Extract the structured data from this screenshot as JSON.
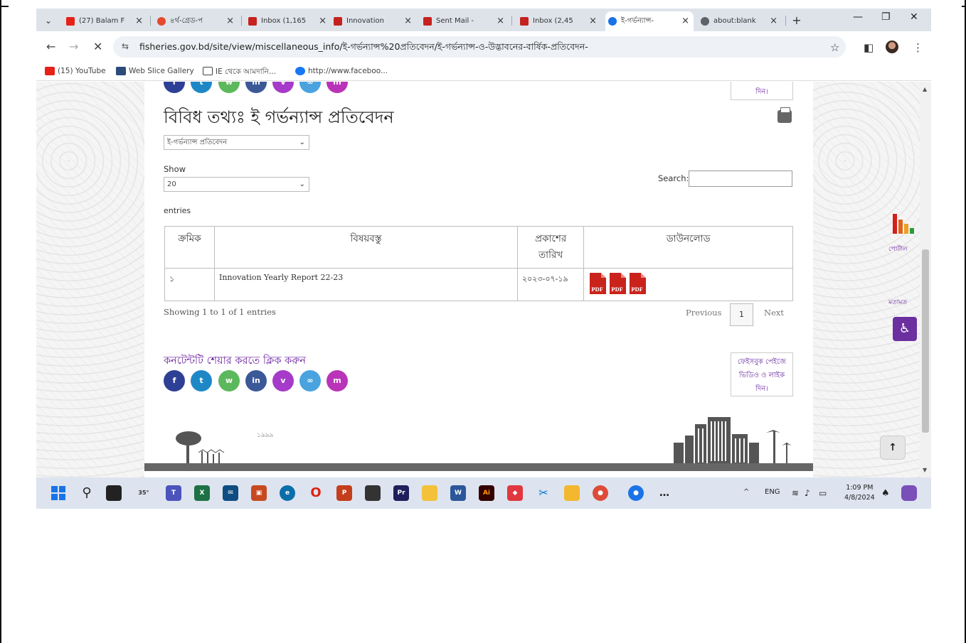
{
  "browser": {
    "tabs": [
      {
        "label": "(27) Balam F",
        "icon_color": "#e62117"
      },
      {
        "label": "৪র্থ-গ্রেড-প",
        "icon_color": "#e6492d"
      },
      {
        "label": "Inbox (1,165",
        "icon_color": "#c5221f"
      },
      {
        "label": "Innovation",
        "icon_color": "#c5221f"
      },
      {
        "label": "Sent Mail -",
        "icon_color": "#c5221f"
      },
      {
        "label": "Inbox (2,45",
        "icon_color": "#c5221f"
      },
      {
        "label": "ই-গর্ভন্যান্স-",
        "icon_color": "#1a73e8"
      },
      {
        "label": "about:blank",
        "icon_color": "#5f6368"
      }
    ],
    "url": "fisheries.gov.bd/site/view/miscellaneous_info/ই-গর্ভন্যান্স%20প্রতিবেদন/ই-গর্ভন্যান্স-ও-উদ্ভাবনের-বার্ষিক-প্রতিবেদন-",
    "bookmarks": [
      {
        "label": "(15) YouTube",
        "icon_color": "#e62117"
      },
      {
        "label": "Web Slice Gallery",
        "icon_color": "#2b4b7a"
      },
      {
        "label": "IE থেকে আমদানি...",
        "icon_color": "#444444"
      },
      {
        "label": "http://www.faceboo...",
        "icon_color": "#1877f2"
      }
    ]
  },
  "page": {
    "title": "বিবিধ তথ্যঃ ই গর্ভন্যান্স প্রতিবেদন",
    "category_select": "ই-গর্ভন্যান্স প্রতিবেদন",
    "show_label": "Show",
    "show_value": "20",
    "entries_label": "entries",
    "search_label": "Search:",
    "table": {
      "headers": [
        "ক্রমিক",
        "বিষয়বস্তু",
        "প্রকাশের তারিখ",
        "ডাউনলোড"
      ],
      "rows": [
        {
          "serial": "১",
          "subject": "Innovation Yearly Report 22-23",
          "date": "২০২৩-০৭-১৯"
        }
      ]
    },
    "showing_text": "Showing 1 to 1 of 1 entries",
    "prev_label": "Previous",
    "page_num": "1",
    "next_label": "Next",
    "share_title": "কনটেন্টটি শেয়ার করতে ক্লিক করুন",
    "feedback_top": "দিন।",
    "feedback_box": [
      "ফেইসবুক পেইজে",
      "ভিডিও ও লাইক",
      "দিন।"
    ],
    "side_widget_1": "পোর্টাল",
    "side_widget_2": "মতামত",
    "footer_signature": "১৯৯৯"
  },
  "share_colors": [
    "#2e3f96",
    "#1e88c7",
    "#5cb85c",
    "#3b5998",
    "#a63ac9",
    "#4aa3df",
    "#b934b8"
  ],
  "taskbar": {
    "weather": "35°",
    "lang": "ENG",
    "time": "1:09 PM",
    "date": "4/8/2024"
  }
}
